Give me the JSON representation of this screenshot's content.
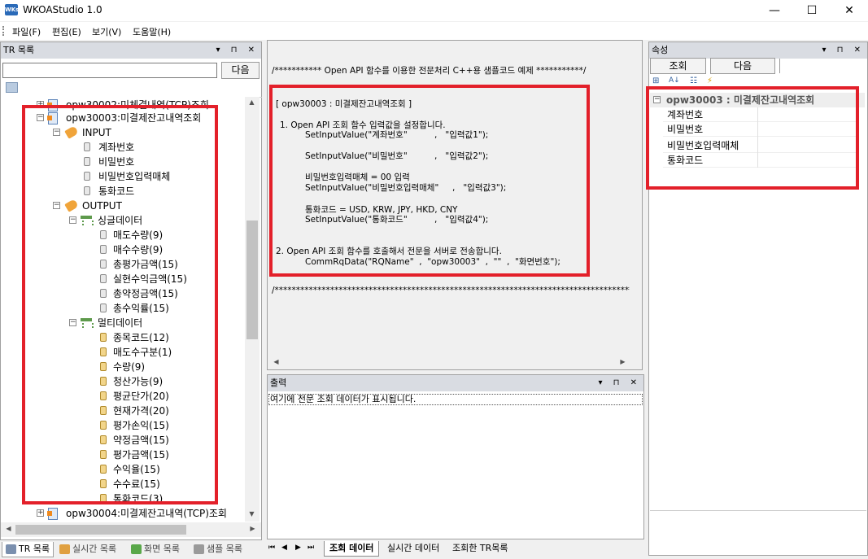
{
  "app": {
    "title": "WKOAStudio 1.0",
    "icon_text": "WKs"
  },
  "window_controls": {
    "minimize": "—",
    "maximize": "☐",
    "close": "✕"
  },
  "menu": [
    "파일(F)",
    "편집(E)",
    "보기(V)",
    "도움말(H)"
  ],
  "tr_panel": {
    "title": "TR 목록",
    "controls": "▾ ⊓ ✕",
    "search_value": "",
    "search_button": "다음",
    "tree": {
      "top_item": "opw30002:미체결내역(TCP)조회",
      "selected_item": "opw30003:미결제잔고내역조회",
      "input_label": "INPUT",
      "input_fields": [
        "계좌번호",
        "비밀번호",
        "비밀번호입력매체",
        "통화코드"
      ],
      "output_label": "OUTPUT",
      "single_label": "싱글데이터",
      "single_fields": [
        "매도수량(9)",
        "매수수량(9)",
        "총평가금액(15)",
        "실현수익금액(15)",
        "총약정금액(15)",
        "총수익률(15)"
      ],
      "multi_label": "멀티데이터",
      "multi_fields": [
        "종목코드(12)",
        "매도수구분(1)",
        "수량(9)",
        "청산가능(9)",
        "평균단가(20)",
        "현재가격(20)",
        "평가손익(15)",
        "약정금액(15)",
        "평가금액(15)",
        "수익율(15)",
        "수수료(15)",
        "통화코드(3)"
      ],
      "bottom_item": "opw30004:미결제잔고내역(TCP)조회"
    },
    "tabs": [
      "TR 목록",
      "실시간 목록",
      "화면 목록",
      "샘플 목록"
    ]
  },
  "code_view": {
    "header": "/*********** Open API 함수를 이용한 전문처리 C++용 샘플코드 예제 ***********/",
    "block_title": "[ opw30003 : 미결제잔고내역조회 ]",
    "step1": "1. Open API 조회 함수 입력값을 설정합니다.",
    "set1": "SetInputValue(\"계좌번호\"          ,   \"입력값1\");",
    "set2": "SetInputValue(\"비밀번호\"          ,   \"입력값2\");",
    "note3": "비밀번호입력매체 = 00 입력",
    "set3": "SetInputValue(\"비밀번호입력매체\"     ,   \"입력값3\");",
    "note4": "통화코드 = USD, KRW, JPY, HKD, CNY",
    "set4": "SetInputValue(\"통화코드\"          ,   \"입력값4\");",
    "step2": "2. Open API 조회 함수를 호출해서 전문을 서버로 전송합니다.",
    "commrq": "CommRqData(\"RQName\"  ,  \"opw30003\"  ,  \"\"  ,  \"화면번호\");",
    "footer": "/**********************************************************************************************"
  },
  "output_panel": {
    "title": "출력",
    "controls": "▾ ⊓ ✕",
    "message": "여기에 전문 조회 데이터가 표시됩니다."
  },
  "center_tabs": [
    "조회 데이터",
    "실시간 데이터",
    "조회한 TR목록"
  ],
  "nav_glyphs": [
    "⏮",
    "◀",
    "▶",
    "⏭"
  ],
  "props_panel": {
    "title": "속성",
    "controls": "▾ ⊓ ✕",
    "query_button": "조회",
    "next_button": "다음",
    "toolbar_glyphs": [
      "⊞",
      "A↓",
      "☷",
      "⚡"
    ],
    "group": "opw30003 : 미결제잔고내역조회",
    "rows": [
      "계좌번호",
      "비밀번호",
      "비밀번호입력매체",
      "통화코드"
    ]
  }
}
